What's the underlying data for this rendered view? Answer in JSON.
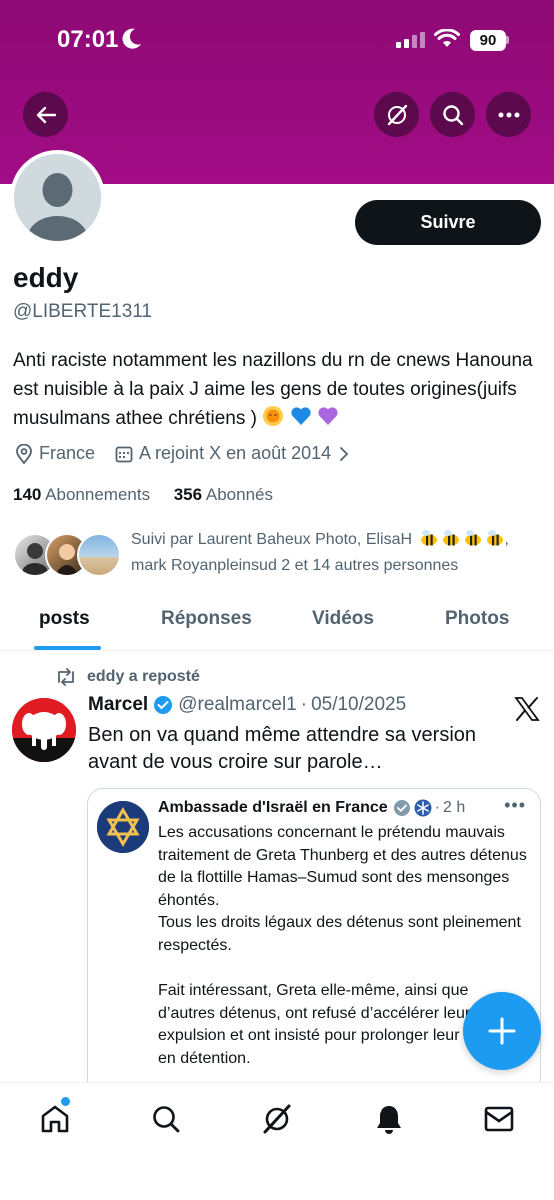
{
  "status_bar": {
    "time": "07:01",
    "battery": "90"
  },
  "profile": {
    "display_name": "eddy",
    "handle": "@LIBERTE1311",
    "follow_label": "Suivre",
    "bio": "Anti raciste notamment les nazillons du rn de cnews Hanouna est nuisible à la paix J aime les gens de toutes origines(juifs musulmans athee chrétiens )",
    "location": "France",
    "joined": "A rejoint X en août 2014",
    "following_count": "140",
    "following_label": "Abonnements",
    "followers_count": "356",
    "followers_label": "Abonnés",
    "followed_by_1": "Suivi par Laurent Baheux Photo, ElisaH",
    "followed_by_2": ",",
    "followed_by_3": "mark Royanpleinsud 2 et 14 autres personnes"
  },
  "tabs": [
    {
      "label": "posts"
    },
    {
      "label": "Réponses"
    },
    {
      "label": "Vidéos"
    },
    {
      "label": "Photos"
    }
  ],
  "post": {
    "repost_label": "eddy a reposté",
    "author_name": "Marcel",
    "author_handle": "@realmarcel1",
    "separator": "·",
    "date": "05/10/2025",
    "text": "Ben on va quand même attendre sa version avant de vous croire sur parole…",
    "quote": {
      "author_name": "Ambassade d'Israël en France",
      "time": "2 h",
      "more": "•••",
      "text": "Les accusations concernant le prétendu mauvais traitement de Greta Thunberg et des autres détenus de la flottille Hamas–Sumud sont des mensonges éhontés.\nTous les droits légaux des détenus sont pleinement respectés.\n\nFait intéressant, Greta elle-même, ainsi que d’autres détenus, ont refusé d’accélérer leur expulsion et ont insisté pour prolonger leur séjour en détention."
    }
  },
  "colors": {
    "banner": "#9b0b80",
    "accent": "#1d9bf0",
    "text": "#0f1419",
    "secondary": "#536471"
  },
  "icons": [
    "back-arrow-icon",
    "grok-icon",
    "search-icon",
    "more-icon",
    "location-pin-icon",
    "calendar-icon",
    "chevron-right-icon",
    "repost-icon",
    "verified-badge-icon",
    "x-logo-icon",
    "compose-plus-icon",
    "home-icon",
    "explore-icon",
    "grok-nav-icon",
    "notifications-icon",
    "messages-icon"
  ]
}
